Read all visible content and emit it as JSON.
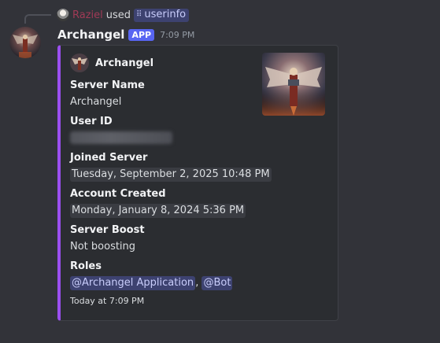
{
  "reply": {
    "username": "Raziel",
    "used_text": "used",
    "command": "userinfo"
  },
  "message": {
    "author": "Archangel",
    "tag": "APP",
    "timestamp": "7:09 PM"
  },
  "embed": {
    "accent_color": "#9b4ff0",
    "author_name": "Archangel",
    "fields": [
      {
        "name": "Server Name",
        "value": "Archangel"
      },
      {
        "name": "User ID",
        "value": ""
      },
      {
        "name": "Joined Server",
        "value": "Tuesday, September 2, 2025 10:48 PM"
      },
      {
        "name": "Account Created",
        "value": "Monday, January 8, 2024 5:36 PM"
      },
      {
        "name": "Server Boost",
        "value": "Not boosting"
      },
      {
        "name": "Roles",
        "value": ""
      }
    ],
    "roles": [
      "@Archangel Application",
      "@Bot"
    ],
    "roles_separator": ",",
    "footer": "Today at 7:09 PM"
  }
}
